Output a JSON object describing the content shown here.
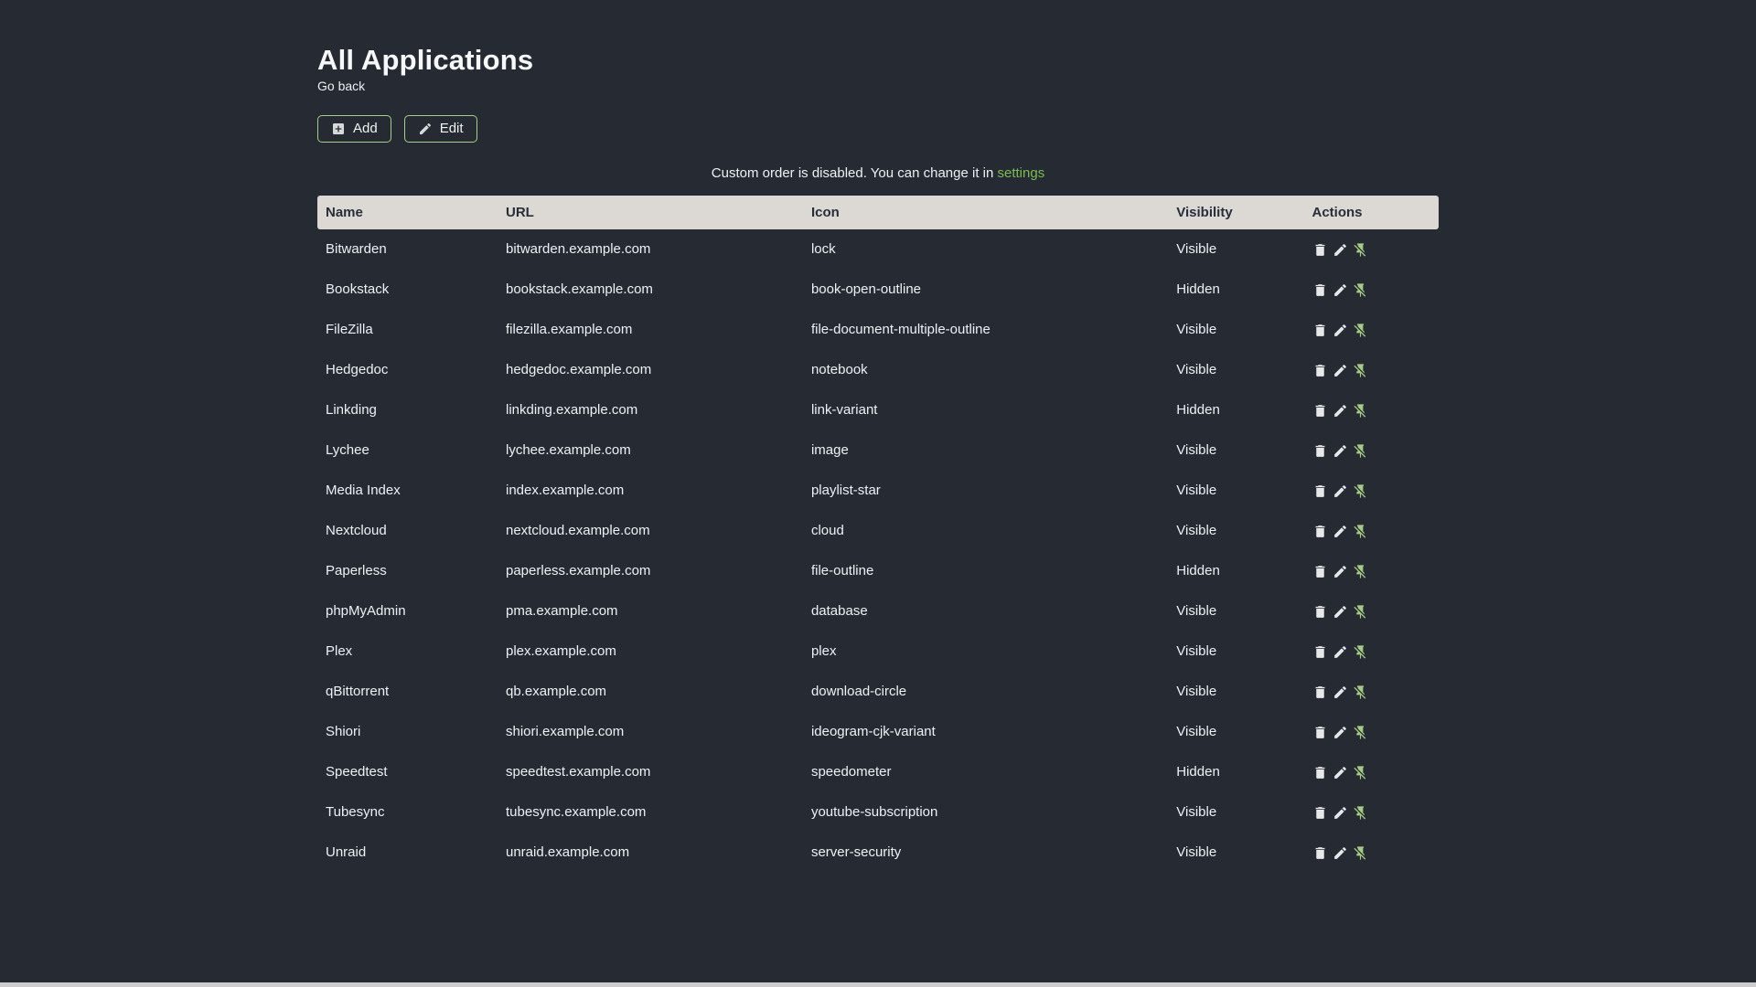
{
  "page": {
    "title": "All Applications",
    "back_link": "Go back",
    "notice": {
      "text": "Custom order is disabled. You can change it in",
      "link": "settings"
    }
  },
  "toolbar": {
    "add_label": "Add",
    "edit_label": "Edit"
  },
  "table": {
    "columns": [
      "Name",
      "URL",
      "Icon",
      "Visibility",
      "Actions"
    ],
    "row_action_icons": [
      "trash-icon",
      "pencil-icon",
      "pin-off-icon"
    ],
    "rows": [
      {
        "name": "Bitwarden",
        "url": "bitwarden.example.com",
        "icon": "lock",
        "visibility": "Visible"
      },
      {
        "name": "Bookstack",
        "url": "bookstack.example.com",
        "icon": "book-open-outline",
        "visibility": "Hidden"
      },
      {
        "name": "FileZilla",
        "url": "filezilla.example.com",
        "icon": "file-document-multiple-outline",
        "visibility": "Visible"
      },
      {
        "name": "Hedgedoc",
        "url": "hedgedoc.example.com",
        "icon": "notebook",
        "visibility": "Visible"
      },
      {
        "name": "Linkding",
        "url": "linkding.example.com",
        "icon": "link-variant",
        "visibility": "Hidden"
      },
      {
        "name": "Lychee",
        "url": "lychee.example.com",
        "icon": "image",
        "visibility": "Visible"
      },
      {
        "name": "Media Index",
        "url": "index.example.com",
        "icon": "playlist-star",
        "visibility": "Visible"
      },
      {
        "name": "Nextcloud",
        "url": "nextcloud.example.com",
        "icon": "cloud",
        "visibility": "Visible"
      },
      {
        "name": "Paperless",
        "url": "paperless.example.com",
        "icon": "file-outline",
        "visibility": "Hidden"
      },
      {
        "name": "phpMyAdmin",
        "url": "pma.example.com",
        "icon": "database",
        "visibility": "Visible"
      },
      {
        "name": "Plex",
        "url": "plex.example.com",
        "icon": "plex",
        "visibility": "Visible"
      },
      {
        "name": "qBittorrent",
        "url": "qb.example.com",
        "icon": "download-circle",
        "visibility": "Visible"
      },
      {
        "name": "Shiori",
        "url": "shiori.example.com",
        "icon": "ideogram-cjk-variant",
        "visibility": "Visible"
      },
      {
        "name": "Speedtest",
        "url": "speedtest.example.com",
        "icon": "speedometer",
        "visibility": "Hidden"
      },
      {
        "name": "Tubesync",
        "url": "tubesync.example.com",
        "icon": "youtube-subscription",
        "visibility": "Visible"
      },
      {
        "name": "Unraid",
        "url": "unraid.example.com",
        "icon": "server-security",
        "visibility": "Visible"
      }
    ]
  },
  "colors": {
    "background": "#262b33",
    "text": "#eef0f3",
    "accent_green_link": "#7cbb52",
    "button_border_green": "#a8cf89",
    "pin_icon_green": "#a5cb85",
    "table_header_bg": "#dcd8d3",
    "table_header_text": "#272e39",
    "bottom_bar": "#cdcdcd"
  }
}
